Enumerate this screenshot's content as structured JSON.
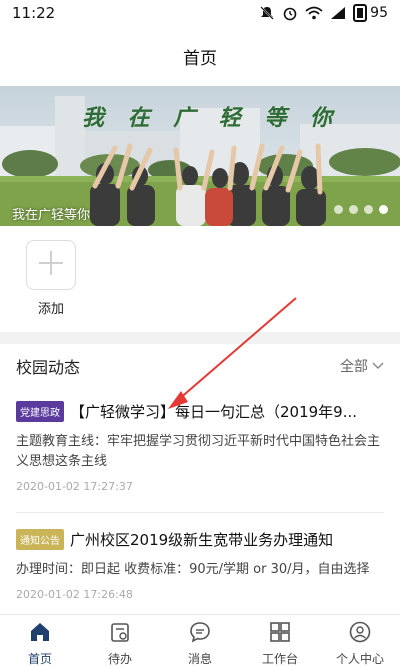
{
  "status_bar": {
    "time": "11:22",
    "battery": "95",
    "icons": [
      "mute-icon",
      "alarm-icon",
      "wifi-icon",
      "signal-icon"
    ]
  },
  "header": {
    "title": "首页"
  },
  "banner": {
    "slogan_chars": [
      "我",
      "在",
      "广",
      "轻",
      "等",
      "你"
    ],
    "caption": "我在广轻等你",
    "slide_count": 4,
    "active_slide": 4
  },
  "quick_actions": {
    "add_label": "添加"
  },
  "news": {
    "title": "校园动态",
    "filter_label": "全部",
    "items": [
      {
        "tag": "党建思政",
        "tag_color": "#5b3a9e",
        "title": "【广轻微学习】每日一句汇总（2019年9...",
        "body": "主题教育主线：牢牢把握学习贯彻习近平新时代中国特色社会主义思想这条主线",
        "time": "2020-01-02 17:27:37"
      },
      {
        "tag": "通知公告",
        "tag_color": "#c9b458",
        "title": "广州校区2019级新生宽带业务办理通知",
        "body": "办理时间：即日起 收费标准：90元/学期 or 30/月，自由选择",
        "time": "2020-01-02 17:26:48"
      }
    ]
  },
  "tab_bar": {
    "active_color": "#1f3f6d",
    "tabs": [
      {
        "label": "首页",
        "icon": "home-icon",
        "active": true
      },
      {
        "label": "待办",
        "icon": "todo-icon",
        "active": false
      },
      {
        "label": "消息",
        "icon": "message-icon",
        "active": false
      },
      {
        "label": "工作台",
        "icon": "workbench-icon",
        "active": false
      },
      {
        "label": "个人中心",
        "icon": "profile-icon",
        "active": false
      }
    ]
  },
  "annotation": {
    "color": "#e53935"
  }
}
